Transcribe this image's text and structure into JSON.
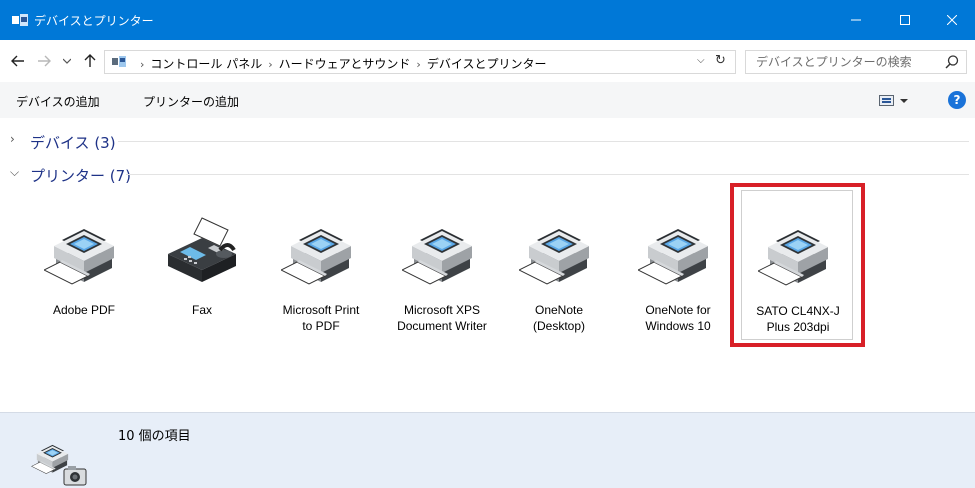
{
  "window": {
    "title": "デバイスとプリンター",
    "controls": {
      "minimize": "—",
      "maximize": "☐",
      "close": "✕"
    }
  },
  "navigation": {
    "back_icon": "arrow-left-icon",
    "forward_icon": "arrow-right-icon",
    "history_icon": "chevron-down-icon",
    "up_icon": "arrow-up-icon"
  },
  "address_bar": {
    "breadcrumbs": [
      "コントロール パネル",
      "ハードウェアとサウンド",
      "デバイスとプリンター"
    ],
    "separator": "›",
    "dropdown": "⌵",
    "refresh": "↻"
  },
  "search": {
    "placeholder": "デバイスとプリンターの検索"
  },
  "toolbar": {
    "add_device": "デバイスの追加",
    "add_printer": "プリンターの追加",
    "help": "?"
  },
  "groups": {
    "devices": {
      "label": "デバイス (3)",
      "chevron": "›",
      "expanded": false
    },
    "printers": {
      "label": "プリンター (7)",
      "chevron": "⌵",
      "expanded": true
    }
  },
  "printers": [
    {
      "name": "Adobe PDF",
      "line1": "Adobe PDF",
      "line2": "",
      "icon": "printer-icon"
    },
    {
      "name": "Fax",
      "line1": "Fax",
      "line2": "",
      "icon": "fax-icon"
    },
    {
      "name": "Microsoft Print to PDF",
      "line1": "Microsoft Print",
      "line2": "to PDF",
      "icon": "printer-icon"
    },
    {
      "name": "Microsoft XPS Document Writer",
      "line1": "Microsoft XPS",
      "line2": "Document Writer",
      "icon": "printer-icon"
    },
    {
      "name": "OneNote (Desktop)",
      "line1": "OneNote",
      "line2": "(Desktop)",
      "icon": "printer-icon"
    },
    {
      "name": "OneNote for Windows 10",
      "line1": "OneNote for",
      "line2": "Windows 10",
      "icon": "printer-icon"
    },
    {
      "name": "SATO CL4NX-J Plus 203dpi",
      "line1": "SATO CL4NX-J",
      "line2": "Plus 203dpi",
      "icon": "printer-icon",
      "highlighted": true
    }
  ],
  "details": {
    "item_count": "10 個の項目",
    "icon": "printer-camera-icon"
  },
  "colors": {
    "titlebar": "#0078d7",
    "group_title": "#1e3287",
    "highlight": "#d82027",
    "details_bg": "#e7eef8"
  }
}
